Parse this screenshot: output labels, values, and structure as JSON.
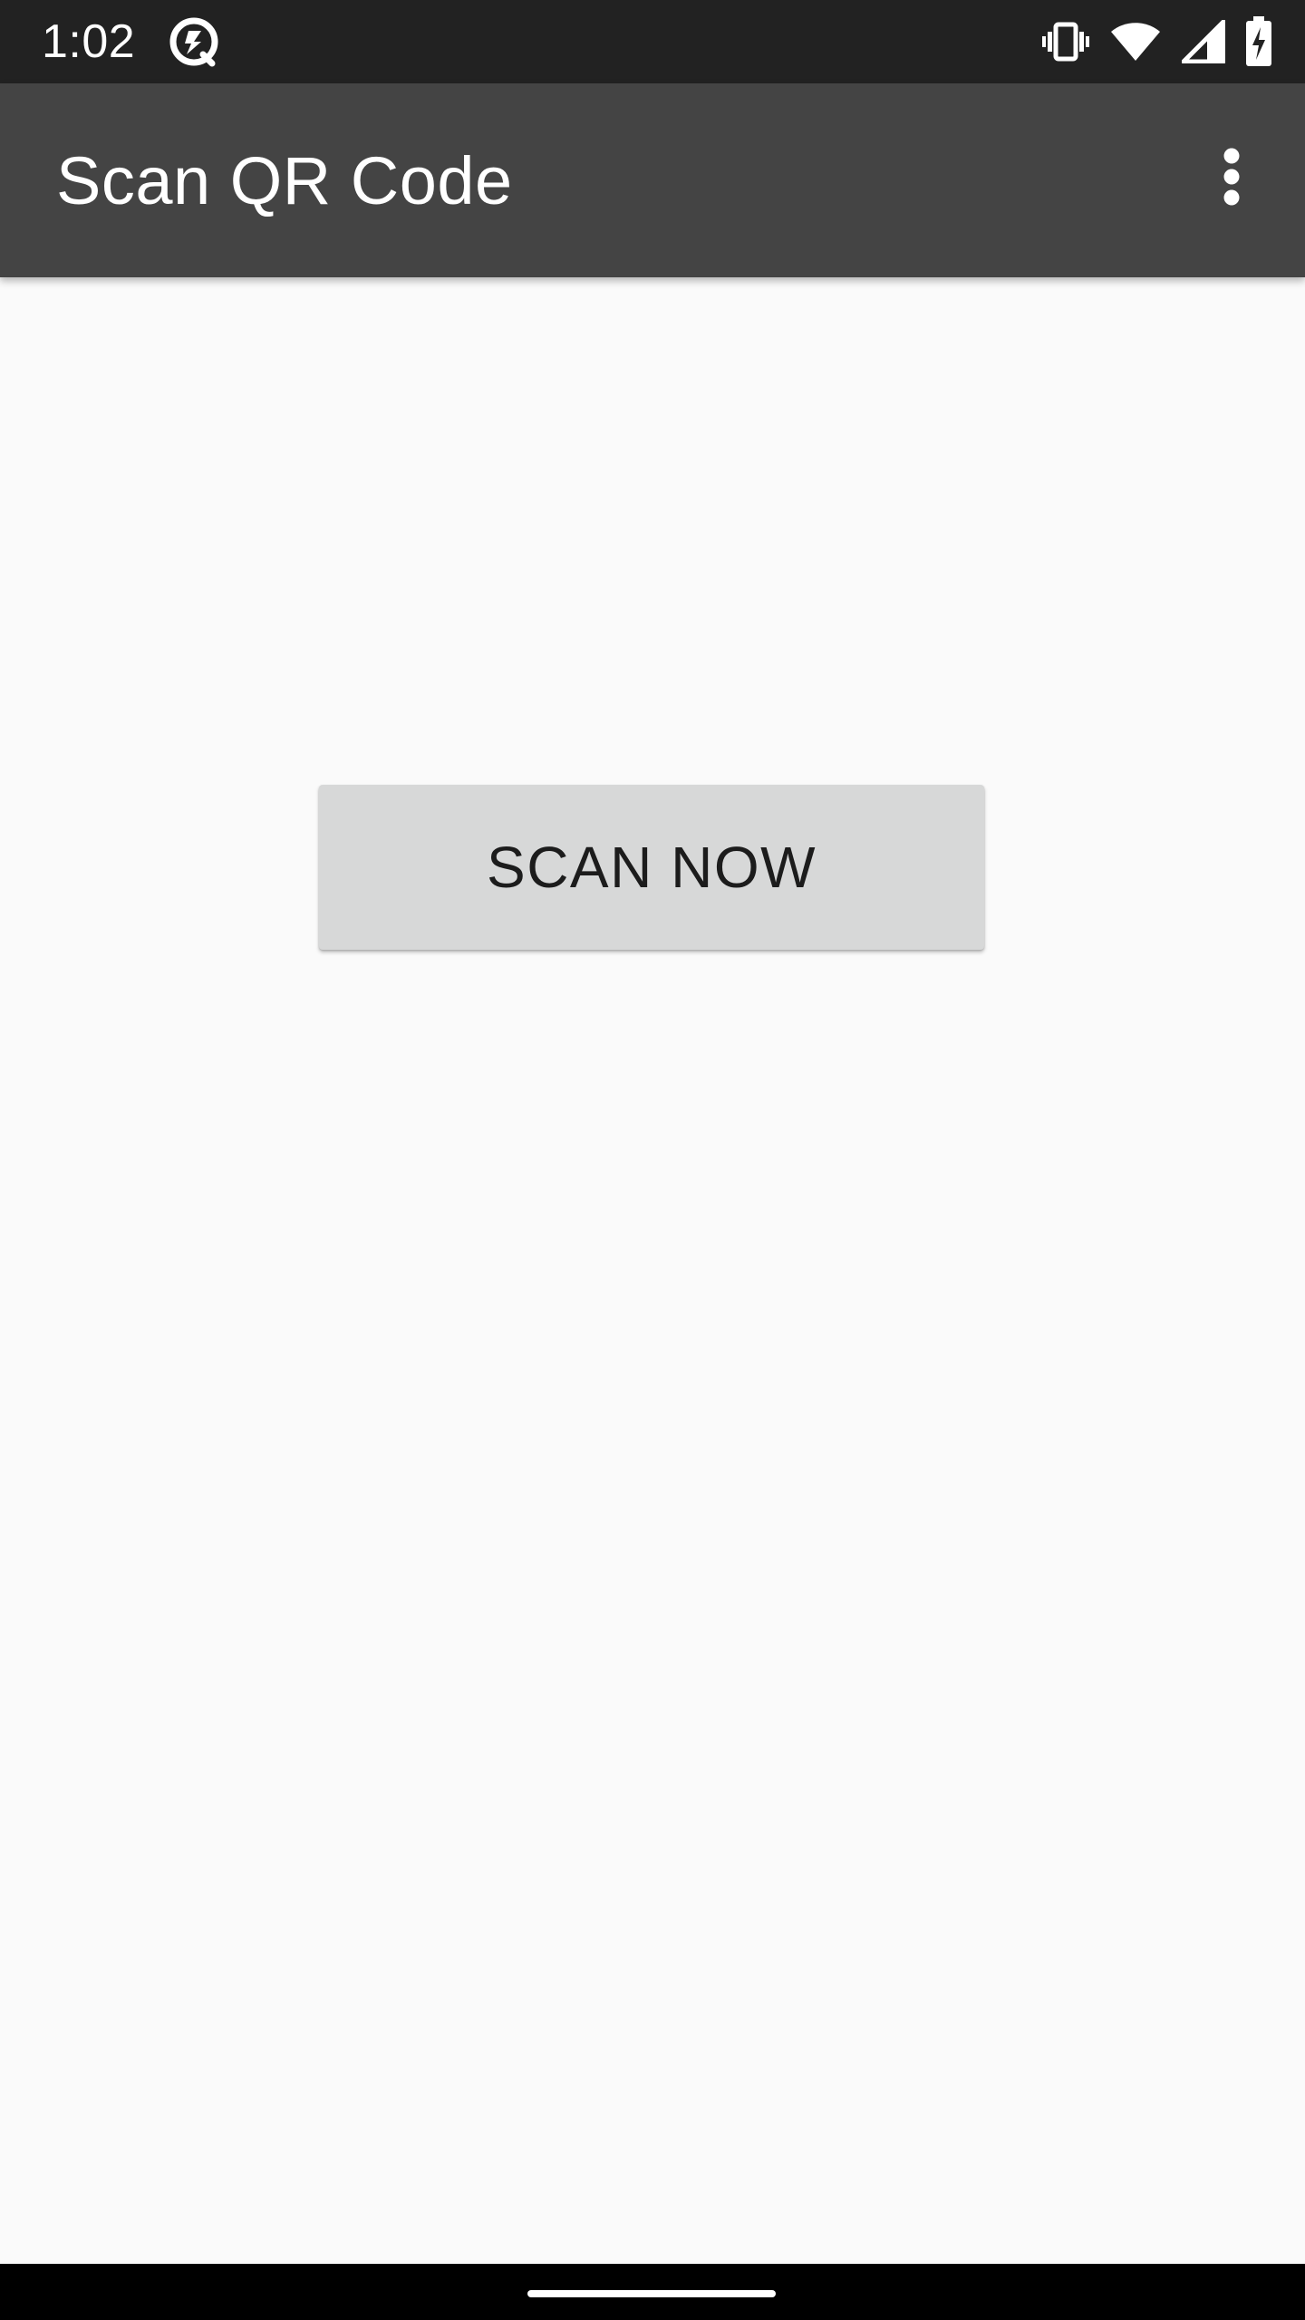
{
  "status_bar": {
    "time": "1:02",
    "app_icon": "data-saver-icon",
    "icons": [
      "vibrate-icon",
      "wifi-icon",
      "cell-signal-icon",
      "battery-charging-icon"
    ]
  },
  "app_bar": {
    "title": "Scan QR Code",
    "menu_icon": "more-vert-icon"
  },
  "main": {
    "scan_button_label": "SCAN NOW"
  },
  "nav_bar": {
    "home_handle": "home-handle"
  },
  "colors": {
    "status_bar": "#222222",
    "app_bar": "#444444",
    "background": "#fafafa",
    "button": "#d7d8d8",
    "button_text": "#1c1c1c",
    "nav_bar": "#000000"
  }
}
